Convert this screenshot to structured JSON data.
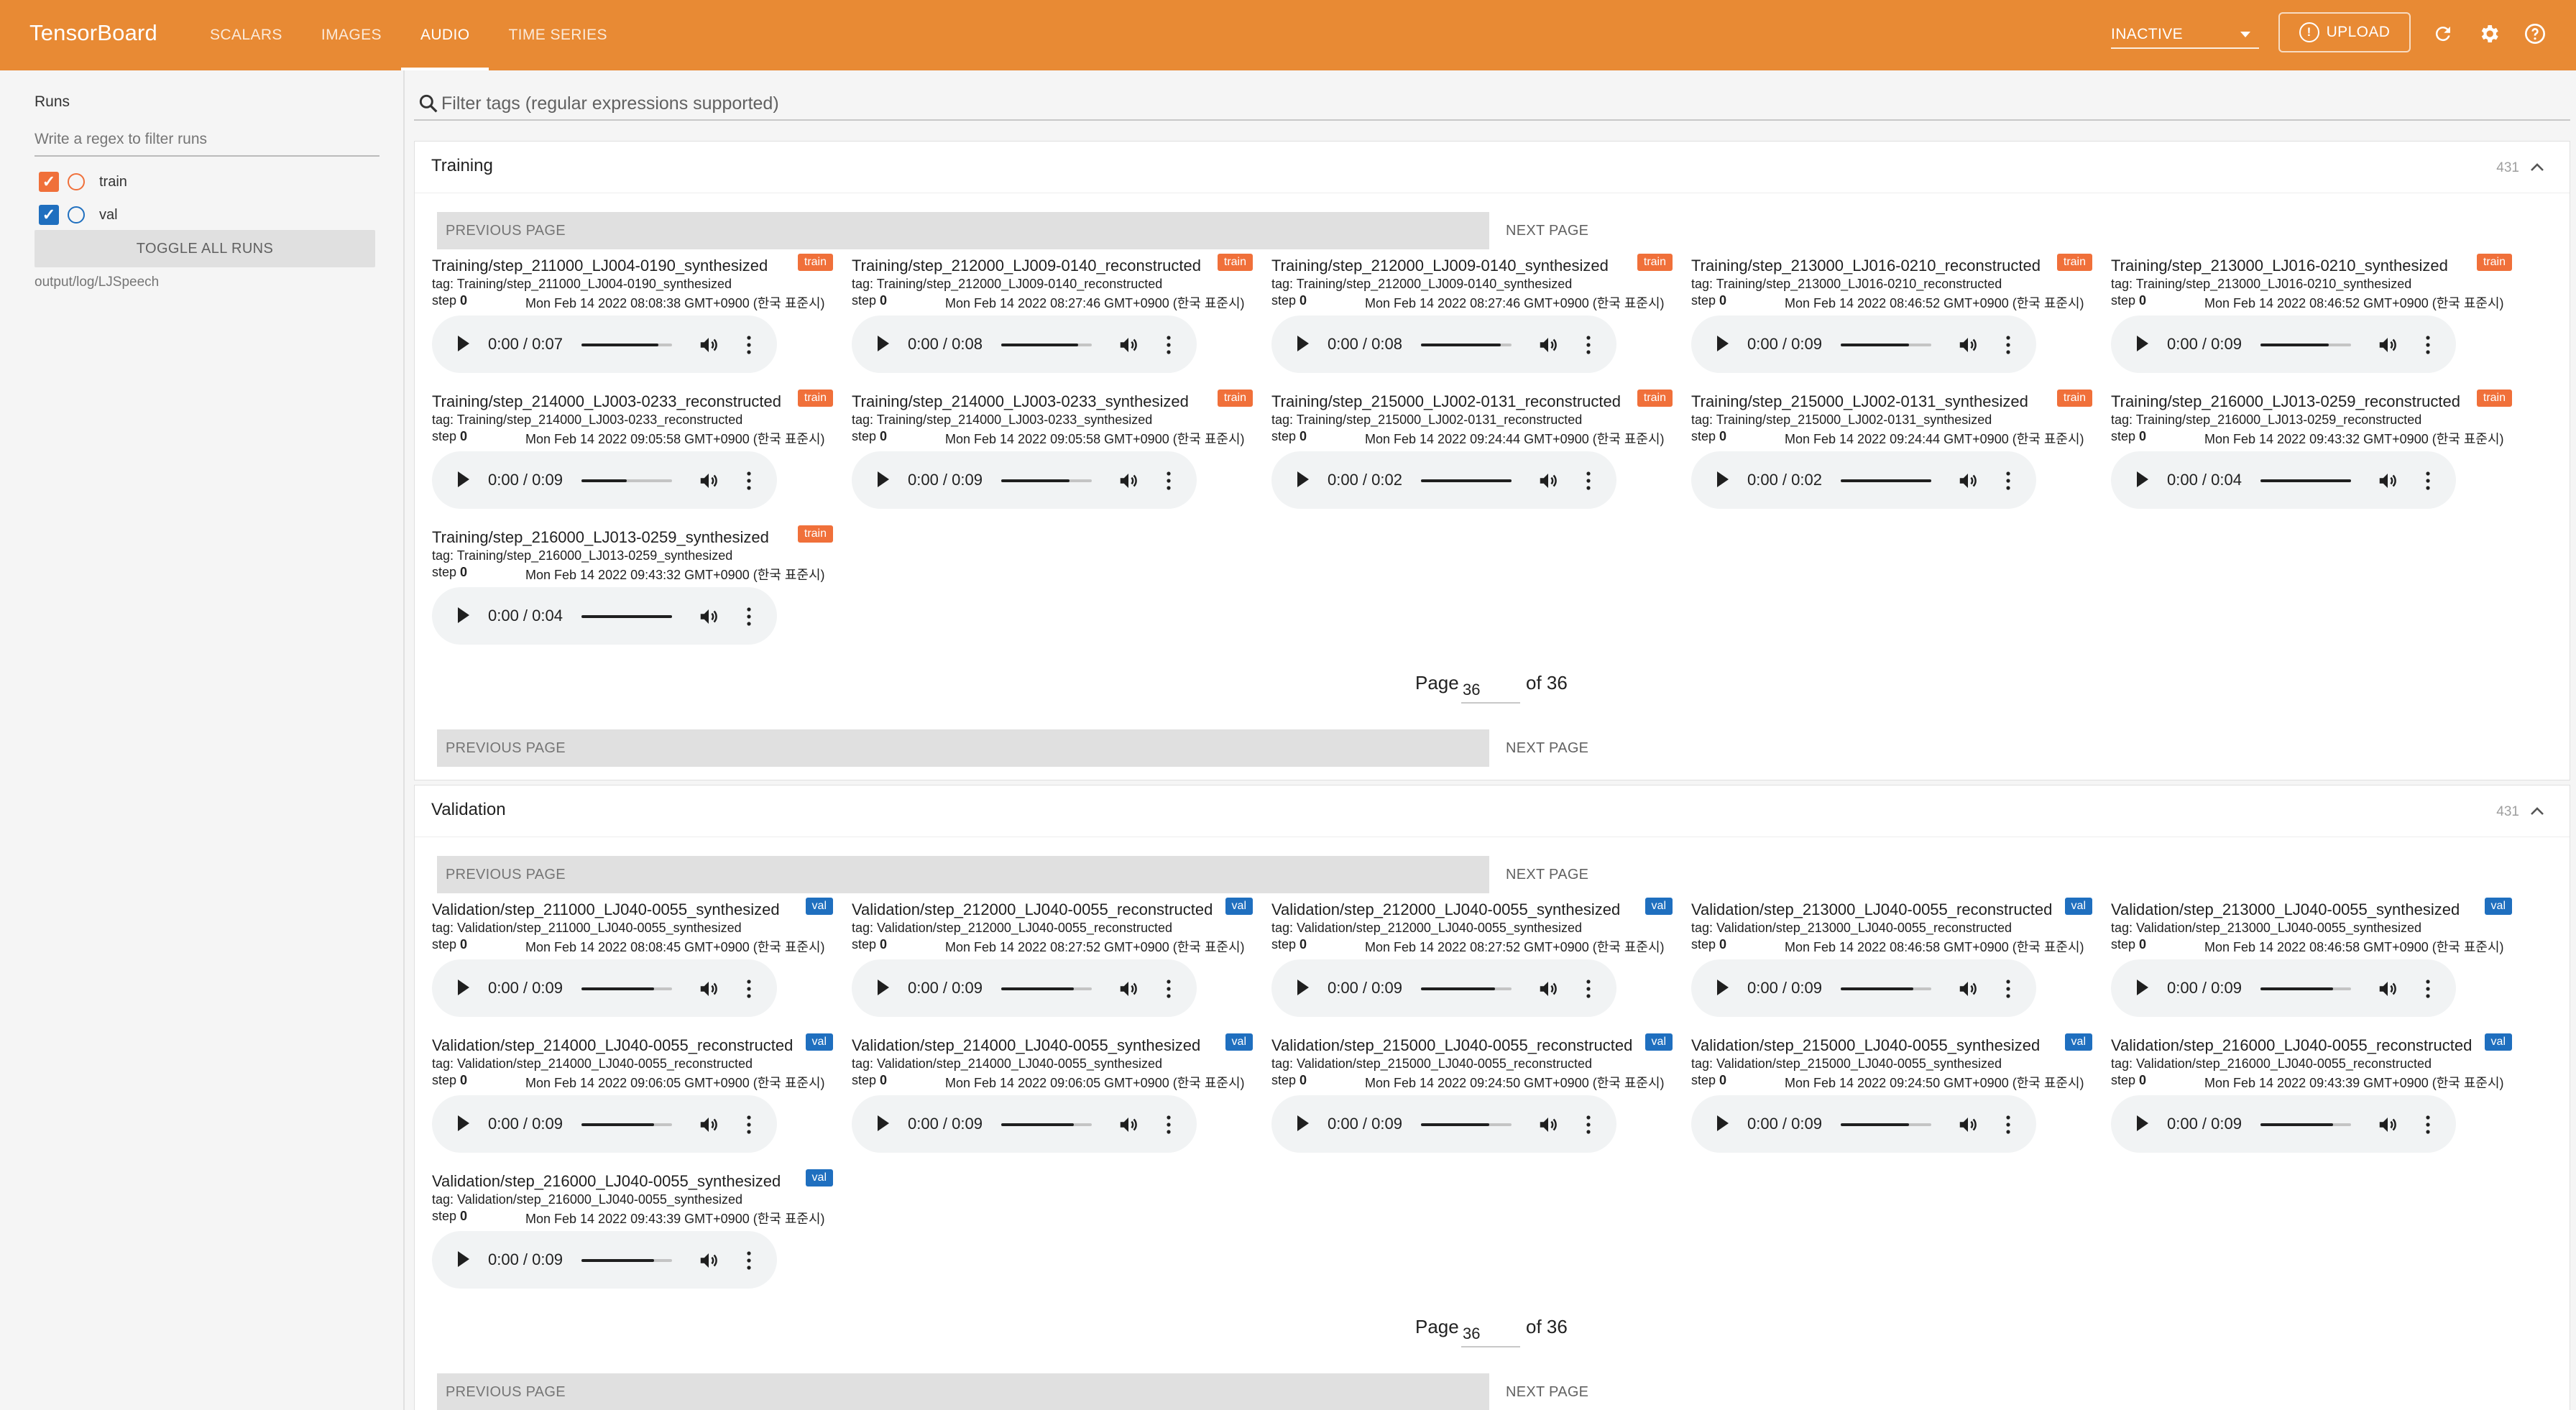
{
  "app": {
    "title": "TensorBoard"
  },
  "tabs": [
    {
      "label": "SCALARS",
      "active": false
    },
    {
      "label": "IMAGES",
      "active": false
    },
    {
      "label": "AUDIO",
      "active": true
    },
    {
      "label": "TIME SERIES",
      "active": false
    }
  ],
  "topbar": {
    "status_select": "INACTIVE",
    "upload_label": "UPLOAD",
    "icons": [
      "refresh-icon",
      "settings-icon",
      "help-icon"
    ]
  },
  "sidebar": {
    "runs_title": "Runs",
    "regex_placeholder": "Write a regex to filter runs",
    "runs": [
      {
        "name": "train",
        "checked": true,
        "color": "#f0703a"
      },
      {
        "name": "val",
        "checked": true,
        "color": "#1f6fbf"
      }
    ],
    "toggle_all_label": "TOGGLE ALL RUNS",
    "logdir": "output/log/LJSpeech"
  },
  "filter": {
    "placeholder": "Filter tags (regular expressions supported)"
  },
  "colors": {
    "accent": "#e88a34",
    "train": "#f0703a",
    "val": "#1f6fbf"
  },
  "pagination": {
    "prev": "PREVIOUS PAGE",
    "next": "NEXT PAGE",
    "page_label": "Page",
    "page_value": "36",
    "of_label": "of 36"
  },
  "groups": [
    {
      "title": "Training",
      "count": "431",
      "cards": [
        {
          "title": "Training/step_211000_LJ004-0190_synthesized",
          "badge": "train",
          "tag": "tag: Training/step_211000_LJ004-0190_synthesized",
          "step_label": "step",
          "step": "0",
          "time": "Mon Feb 14 2022 08:08:38 GMT+0900 (한국 표준시)",
          "player_time": "0:00 / 0:07",
          "volume": 0.85
        },
        {
          "title": "Training/step_212000_LJ009-0140_reconstructed",
          "badge": "train",
          "tag": "tag: Training/step_212000_LJ009-0140_reconstructed",
          "step_label": "step",
          "step": "0",
          "time": "Mon Feb 14 2022 08:27:46 GMT+0900 (한국 표준시)",
          "player_time": "0:00 / 0:08",
          "volume": 0.85
        },
        {
          "title": "Training/step_212000_LJ009-0140_synthesized",
          "badge": "train",
          "tag": "tag: Training/step_212000_LJ009-0140_synthesized",
          "step_label": "step",
          "step": "0",
          "time": "Mon Feb 14 2022 08:27:46 GMT+0900 (한국 표준시)",
          "player_time": "0:00 / 0:08",
          "volume": 0.88
        },
        {
          "title": "Training/step_213000_LJ016-0210_reconstructed",
          "badge": "train",
          "tag": "tag: Training/step_213000_LJ016-0210_reconstructed",
          "step_label": "step",
          "step": "0",
          "time": "Mon Feb 14 2022 08:46:52 GMT+0900 (한국 표준시)",
          "player_time": "0:00 / 0:09",
          "volume": 0.75
        },
        {
          "title": "Training/step_213000_LJ016-0210_synthesized",
          "badge": "train",
          "tag": "tag: Training/step_213000_LJ016-0210_synthesized",
          "step_label": "step",
          "step": "0",
          "time": "Mon Feb 14 2022 08:46:52 GMT+0900 (한국 표준시)",
          "player_time": "0:00 / 0:09",
          "volume": 0.75
        },
        {
          "title": "Training/step_214000_LJ003-0233_reconstructed",
          "badge": "train",
          "tag": "tag: Training/step_214000_LJ003-0233_reconstructed",
          "step_label": "step",
          "step": "0",
          "time": "Mon Feb 14 2022 09:05:58 GMT+0900 (한국 표준시)",
          "player_time": "0:00 / 0:09",
          "volume": 0.5
        },
        {
          "title": "Training/step_214000_LJ003-0233_synthesized",
          "badge": "train",
          "tag": "tag: Training/step_214000_LJ003-0233_synthesized",
          "step_label": "step",
          "step": "0",
          "time": "Mon Feb 14 2022 09:05:58 GMT+0900 (한국 표준시)",
          "player_time": "0:00 / 0:09",
          "volume": 0.75
        },
        {
          "title": "Training/step_215000_LJ002-0131_reconstructed",
          "badge": "train",
          "tag": "tag: Training/step_215000_LJ002-0131_reconstructed",
          "step_label": "step",
          "step": "0",
          "time": "Mon Feb 14 2022 09:24:44 GMT+0900 (한국 표준시)",
          "player_time": "0:00 / 0:02",
          "volume": 1
        },
        {
          "title": "Training/step_215000_LJ002-0131_synthesized",
          "badge": "train",
          "tag": "tag: Training/step_215000_LJ002-0131_synthesized",
          "step_label": "step",
          "step": "0",
          "time": "Mon Feb 14 2022 09:24:44 GMT+0900 (한국 표준시)",
          "player_time": "0:00 / 0:02",
          "volume": 1
        },
        {
          "title": "Training/step_216000_LJ013-0259_reconstructed",
          "badge": "train",
          "tag": "tag: Training/step_216000_LJ013-0259_reconstructed",
          "step_label": "step",
          "step": "0",
          "time": "Mon Feb 14 2022 09:43:32 GMT+0900 (한국 표준시)",
          "player_time": "0:00 / 0:04",
          "volume": 1
        },
        {
          "title": "Training/step_216000_LJ013-0259_synthesized",
          "badge": "train",
          "tag": "tag: Training/step_216000_LJ013-0259_synthesized",
          "step_label": "step",
          "step": "0",
          "time": "Mon Feb 14 2022 09:43:32 GMT+0900 (한국 표준시)",
          "player_time": "0:00 / 0:04",
          "volume": 1
        }
      ]
    },
    {
      "title": "Validation",
      "count": "431",
      "cards": [
        {
          "title": "Validation/step_211000_LJ040-0055_synthesized",
          "badge": "val",
          "tag": "tag: Validation/step_211000_LJ040-0055_synthesized",
          "step_label": "step",
          "step": "0",
          "time": "Mon Feb 14 2022 08:08:45 GMT+0900 (한국 표준시)",
          "player_time": "0:00 / 0:09",
          "volume": 0.8
        },
        {
          "title": "Validation/step_212000_LJ040-0055_reconstructed",
          "badge": "val",
          "tag": "tag: Validation/step_212000_LJ040-0055_reconstructed",
          "step_label": "step",
          "step": "0",
          "time": "Mon Feb 14 2022 08:27:52 GMT+0900 (한국 표준시)",
          "player_time": "0:00 / 0:09",
          "volume": 0.8
        },
        {
          "title": "Validation/step_212000_LJ040-0055_synthesized",
          "badge": "val",
          "tag": "tag: Validation/step_212000_LJ040-0055_synthesized",
          "step_label": "step",
          "step": "0",
          "time": "Mon Feb 14 2022 08:27:52 GMT+0900 (한국 표준시)",
          "player_time": "0:00 / 0:09",
          "volume": 0.82
        },
        {
          "title": "Validation/step_213000_LJ040-0055_reconstructed",
          "badge": "val",
          "tag": "tag: Validation/step_213000_LJ040-0055_reconstructed",
          "step_label": "step",
          "step": "0",
          "time": "Mon Feb 14 2022 08:46:58 GMT+0900 (한국 표준시)",
          "player_time": "0:00 / 0:09",
          "volume": 0.8
        },
        {
          "title": "Validation/step_213000_LJ040-0055_synthesized",
          "badge": "val",
          "tag": "tag: Validation/step_213000_LJ040-0055_synthesized",
          "step_label": "step",
          "step": "0",
          "time": "Mon Feb 14 2022 08:46:58 GMT+0900 (한국 표준시)",
          "player_time": "0:00 / 0:09",
          "volume": 0.8
        },
        {
          "title": "Validation/step_214000_LJ040-0055_reconstructed",
          "badge": "val",
          "tag": "tag: Validation/step_214000_LJ040-0055_reconstructed",
          "step_label": "step",
          "step": "0",
          "time": "Mon Feb 14 2022 09:06:05 GMT+0900 (한국 표준시)",
          "player_time": "0:00 / 0:09",
          "volume": 0.8
        },
        {
          "title": "Validation/step_214000_LJ040-0055_synthesized",
          "badge": "val",
          "tag": "tag: Validation/step_214000_LJ040-0055_synthesized",
          "step_label": "step",
          "step": "0",
          "time": "Mon Feb 14 2022 09:06:05 GMT+0900 (한국 표준시)",
          "player_time": "0:00 / 0:09",
          "volume": 0.8
        },
        {
          "title": "Validation/step_215000_LJ040-0055_reconstructed",
          "badge": "val",
          "tag": "tag: Validation/step_215000_LJ040-0055_reconstructed",
          "step_label": "step",
          "step": "0",
          "time": "Mon Feb 14 2022 09:24:50 GMT+0900 (한국 표준시)",
          "player_time": "0:00 / 0:09",
          "volume": 0.75
        },
        {
          "title": "Validation/step_215000_LJ040-0055_synthesized",
          "badge": "val",
          "tag": "tag: Validation/step_215000_LJ040-0055_synthesized",
          "step_label": "step",
          "step": "0",
          "time": "Mon Feb 14 2022 09:24:50 GMT+0900 (한국 표준시)",
          "player_time": "0:00 / 0:09",
          "volume": 0.75
        },
        {
          "title": "Validation/step_216000_LJ040-0055_reconstructed",
          "badge": "val",
          "tag": "tag: Validation/step_216000_LJ040-0055_reconstructed",
          "step_label": "step",
          "step": "0",
          "time": "Mon Feb 14 2022 09:43:39 GMT+0900 (한국 표준시)",
          "player_time": "0:00 / 0:09",
          "volume": 0.8
        },
        {
          "title": "Validation/step_216000_LJ040-0055_synthesized",
          "badge": "val",
          "tag": "tag: Validation/step_216000_LJ040-0055_synthesized",
          "step_label": "step",
          "step": "0",
          "time": "Mon Feb 14 2022 09:43:39 GMT+0900 (한국 표준시)",
          "player_time": "0:00 / 0:09",
          "volume": 0.8
        }
      ]
    }
  ]
}
